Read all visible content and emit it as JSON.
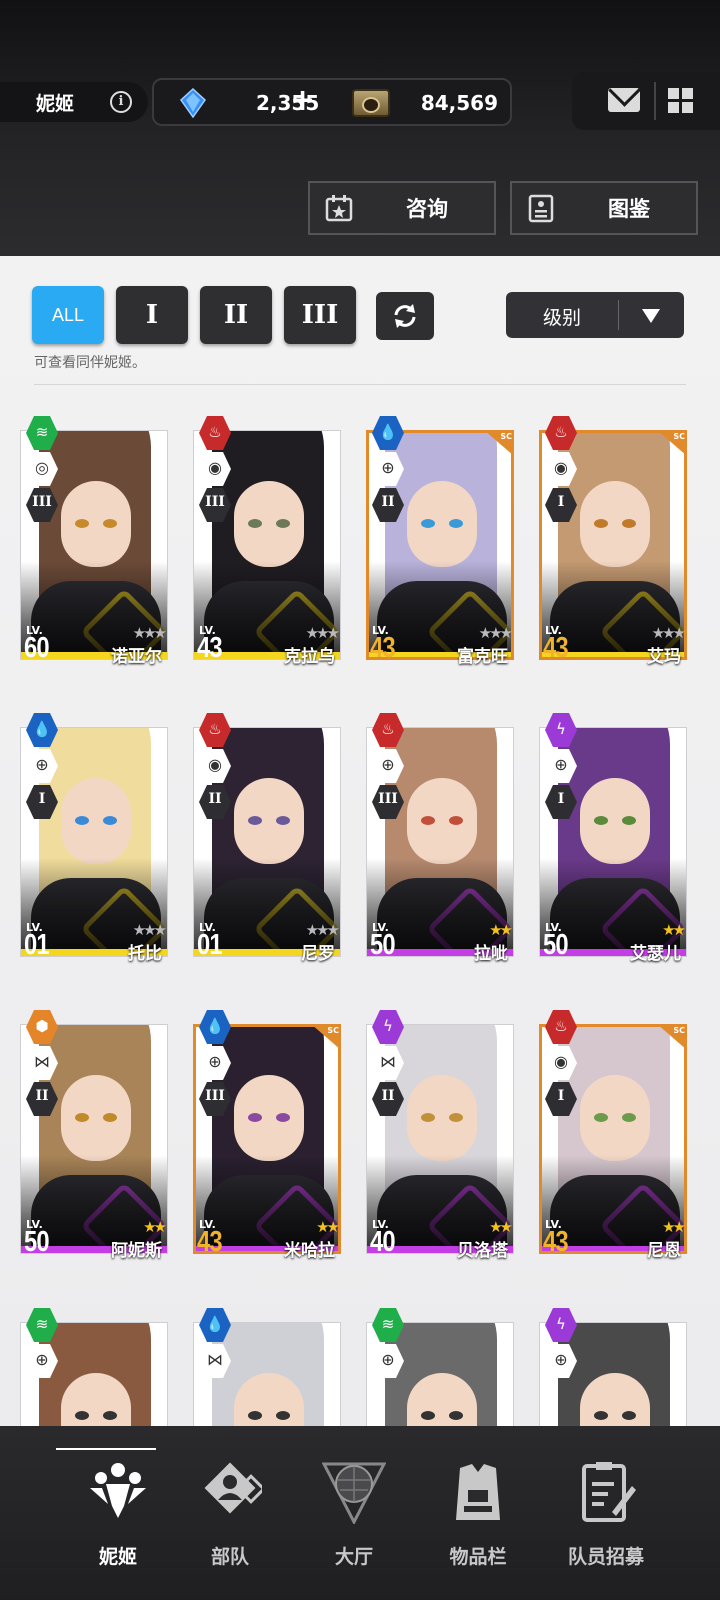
{
  "header": {
    "title": "妮姬",
    "gems": "2,355",
    "gems_plus": "+",
    "credits": "84,569",
    "consult_label": "咨询",
    "archive_label": "图鉴"
  },
  "filters": {
    "all_label": "ALL",
    "burst1_label": "I",
    "burst2_label": "II",
    "burst3_label": "III",
    "sort_label": "级别",
    "hint": "可查看同伴妮姬。"
  },
  "colors": {
    "accent": "#29aaf2",
    "wind": "#1fae4a",
    "fire": "#c62a2a",
    "water": "#1b63c2",
    "electric": "#9b3ad6",
    "iron": "#e4852a",
    "ssr_yellow": "#f4d61e",
    "sr_purple": "#c43ee6",
    "sc_orange": "#e08a2c"
  },
  "characters": [
    {
      "name": "诺亚尔",
      "level": "60",
      "lv_label": "LV.",
      "element": "wind-icon",
      "element_glyph": "≋",
      "class_glyph": "◎",
      "burst": "III",
      "rarity": "SSR",
      "stars": "★★★",
      "sc": false
    },
    {
      "name": "克拉乌",
      "level": "43",
      "lv_label": "LV.",
      "element": "fire-icon",
      "element_glyph": "♨",
      "class_glyph": "◉",
      "burst": "III",
      "rarity": "SSR",
      "stars": "★★★",
      "sc": false
    },
    {
      "name": "富克旺",
      "level": "43",
      "lv_label": "LV.",
      "element": "water-icon",
      "element_glyph": "💧",
      "class_glyph": "⊕",
      "burst": "II",
      "rarity": "SSR",
      "stars": "★★★",
      "sc": true
    },
    {
      "name": "艾玛",
      "level": "43",
      "lv_label": "LV.",
      "element": "fire-icon",
      "element_glyph": "♨",
      "class_glyph": "◉",
      "burst": "I",
      "rarity": "SSR",
      "stars": "★★★",
      "sc": true
    },
    {
      "name": "托比",
      "level": "01",
      "lv_label": "LV.",
      "element": "water-icon",
      "element_glyph": "💧",
      "class_glyph": "⊕",
      "burst": "I",
      "rarity": "SSR",
      "stars": "★★★",
      "sc": false
    },
    {
      "name": "尼罗",
      "level": "01",
      "lv_label": "LV.",
      "element": "fire-icon",
      "element_glyph": "♨",
      "class_glyph": "◉",
      "burst": "II",
      "rarity": "SSR",
      "stars": "★★★",
      "sc": false
    },
    {
      "name": "拉呲",
      "level": "50",
      "lv_label": "LV.",
      "element": "fire-icon",
      "element_glyph": "♨",
      "class_glyph": "⊕",
      "burst": "III",
      "rarity": "SR",
      "stars": "★★",
      "sc": false
    },
    {
      "name": "艾瑟儿",
      "level": "50",
      "lv_label": "LV.",
      "element": "electric-icon",
      "element_glyph": "ϟ",
      "class_glyph": "⊕",
      "burst": "I",
      "rarity": "SR",
      "stars": "★★",
      "sc": false
    },
    {
      "name": "阿妮斯",
      "level": "50",
      "lv_label": "LV.",
      "element": "iron-icon",
      "element_glyph": "⬢",
      "class_glyph": "⋈",
      "burst": "II",
      "rarity": "SR",
      "stars": "★★",
      "sc": false
    },
    {
      "name": "米哈拉",
      "level": "43",
      "lv_label": "LV.",
      "element": "water-icon",
      "element_glyph": "💧",
      "class_glyph": "⊕",
      "burst": "III",
      "rarity": "SR",
      "stars": "★★",
      "sc": true
    },
    {
      "name": "贝洛塔",
      "level": "40",
      "lv_label": "LV.",
      "element": "electric-icon",
      "element_glyph": "ϟ",
      "class_glyph": "⋈",
      "burst": "II",
      "rarity": "SR",
      "stars": "★★",
      "sc": false
    },
    {
      "name": "尼恩",
      "level": "43",
      "lv_label": "LV.",
      "element": "fire-icon",
      "element_glyph": "♨",
      "class_glyph": "◉",
      "burst": "I",
      "rarity": "SR",
      "stars": "★★",
      "sc": true
    },
    {
      "name": "",
      "level": "",
      "lv_label": "",
      "element": "wind-icon",
      "element_glyph": "≋",
      "class_glyph": "⊕",
      "burst": "",
      "rarity": "",
      "stars": "",
      "sc": false
    },
    {
      "name": "",
      "level": "",
      "lv_label": "",
      "element": "water-icon",
      "element_glyph": "💧",
      "class_glyph": "⋈",
      "burst": "",
      "rarity": "",
      "stars": "",
      "sc": false
    },
    {
      "name": "",
      "level": "",
      "lv_label": "",
      "element": "wind-icon",
      "element_glyph": "≋",
      "class_glyph": "⊕",
      "burst": "",
      "rarity": "",
      "stars": "",
      "sc": false
    },
    {
      "name": "",
      "level": "",
      "lv_label": "",
      "element": "electric-icon",
      "element_glyph": "ϟ",
      "class_glyph": "⊕",
      "burst": "",
      "rarity": "",
      "stars": "",
      "sc": false
    }
  ],
  "nav": [
    {
      "label": "妮姬",
      "icon": "nikke-icon",
      "active": true
    },
    {
      "label": "部队",
      "icon": "squad-icon",
      "active": false
    },
    {
      "label": "大厅",
      "icon": "lobby-icon",
      "active": false
    },
    {
      "label": "物品栏",
      "icon": "inventory-icon",
      "active": false
    },
    {
      "label": "队员招募",
      "icon": "recruit-icon",
      "active": false
    }
  ]
}
